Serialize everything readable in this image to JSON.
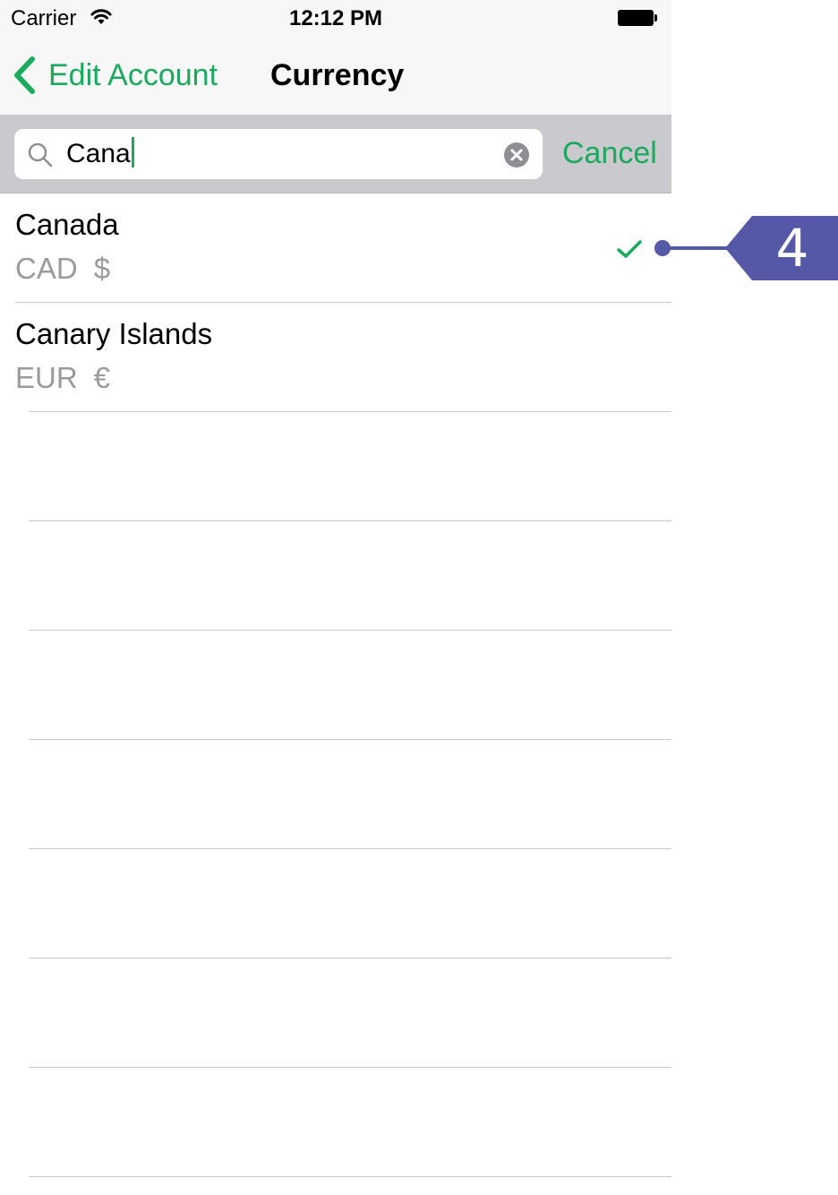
{
  "status_bar": {
    "carrier": "Carrier",
    "time": "12:12 PM"
  },
  "nav": {
    "back_label": "Edit Account",
    "title": "Currency"
  },
  "search": {
    "value": "Cana",
    "cancel_label": "Cancel"
  },
  "results": [
    {
      "country": "Canada",
      "code": "CAD",
      "symbol": "$",
      "selected": true
    },
    {
      "country": "Canary Islands",
      "code": "EUR",
      "symbol": "€",
      "selected": false
    }
  ],
  "annotation": {
    "number": "4"
  },
  "colors": {
    "accent": "#1aaa5e",
    "callout": "#5558a6",
    "subtitle": "#9b9b9b",
    "searchbar_bg": "#c9c9ce"
  },
  "icons": [
    "wifi-icon",
    "battery-icon",
    "chevron-left-icon",
    "search-icon",
    "clear-icon",
    "checkmark-icon"
  ]
}
